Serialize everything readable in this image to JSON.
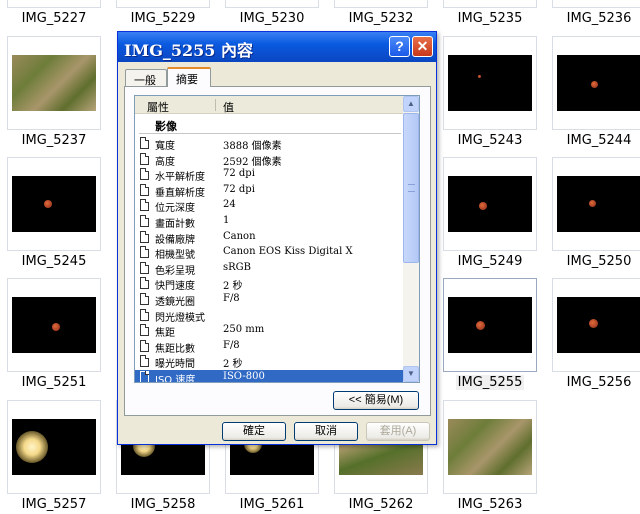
{
  "explorer": {
    "thumbnails": [
      {
        "name": "IMG_5227"
      },
      {
        "name": "IMG_5229"
      },
      {
        "name": "IMG_5230"
      },
      {
        "name": "IMG_5232"
      },
      {
        "name": "IMG_5235"
      },
      {
        "name": "IMG_5236"
      },
      {
        "name": "IMG_5237"
      },
      {
        "name": "IMG_5243"
      },
      {
        "name": "IMG_5244"
      },
      {
        "name": "IMG_5245"
      },
      {
        "name": "IMG_5249"
      },
      {
        "name": "IMG_5250"
      },
      {
        "name": "IMG_5251"
      },
      {
        "name": "IMG_5255"
      },
      {
        "name": "IMG_5256"
      },
      {
        "name": "IMG_5257"
      },
      {
        "name": "IMG_5258"
      },
      {
        "name": "IMG_5261"
      },
      {
        "name": "IMG_5262"
      },
      {
        "name": "IMG_5263"
      }
    ],
    "selected": "IMG_5255"
  },
  "dialog": {
    "title": "IMG_5255 內容",
    "help_label": "?",
    "close_label": "✕",
    "tabs": [
      {
        "label": "一般",
        "active": false
      },
      {
        "label": "摘要",
        "active": true
      }
    ],
    "columns": {
      "property": "屬性",
      "value": "值"
    },
    "section": "影像",
    "properties": [
      {
        "name": "寬度",
        "value": "3888 個像素"
      },
      {
        "name": "高度",
        "value": "2592 個像素"
      },
      {
        "name": "水平解析度",
        "value": "72 dpi"
      },
      {
        "name": "垂直解析度",
        "value": "72 dpi"
      },
      {
        "name": "位元深度",
        "value": "24"
      },
      {
        "name": "畫面計數",
        "value": "1"
      },
      {
        "name": "設備廠牌",
        "value": "Canon"
      },
      {
        "name": "相機型號",
        "value": "Canon EOS Kiss Digital X"
      },
      {
        "name": "色彩呈現",
        "value": "sRGB"
      },
      {
        "name": "快門速度",
        "value": "2 秒"
      },
      {
        "name": "透鏡光圈",
        "value": "F/8"
      },
      {
        "name": "閃光燈模式",
        "value": ""
      },
      {
        "name": "焦距",
        "value": "250 mm"
      },
      {
        "name": "焦距比數",
        "value": "F/8"
      },
      {
        "name": "曝光時間",
        "value": "2 秒"
      },
      {
        "name": "ISO 速度",
        "value": "ISO-800",
        "selected": true
      }
    ],
    "buttons": {
      "simple": "<< 簡易(M)",
      "ok": "確定",
      "cancel": "取消",
      "apply": "套用(A)"
    },
    "accent_colors": {
      "title_bar": "#0a5ae0",
      "selection": "#316ac5",
      "close": "#c8381a"
    }
  }
}
